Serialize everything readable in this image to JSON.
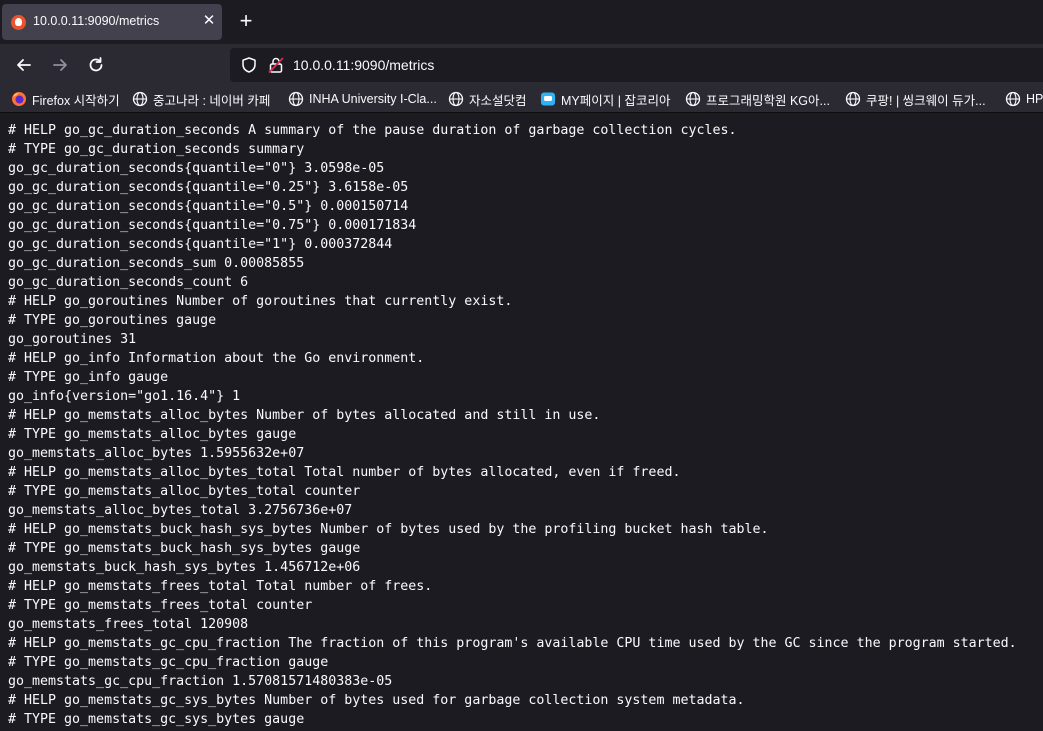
{
  "tab": {
    "title": "10.0.0.11:9090/metrics",
    "close": "✕"
  },
  "newtab": "+",
  "url": "10.0.0.11:9090/metrics",
  "bookmarks": [
    {
      "label": "Firefox 시작하기",
      "icon": "firefox-icon"
    },
    {
      "label": "중고나라 : 네이버 카페",
      "icon": "globe-icon"
    },
    {
      "label": "INHA University I-Cla...",
      "icon": "globe-icon"
    },
    {
      "label": "자소설닷컴",
      "icon": "globe-icon"
    },
    {
      "label": "MY페이지 | 잡코리아",
      "icon": "chat-icon"
    },
    {
      "label": "프로그래밍학원 KG아...",
      "icon": "globe-icon"
    },
    {
      "label": "쿠팡! | 씽크웨이 듀가...",
      "icon": "globe-icon"
    },
    {
      "label": "HP",
      "icon": "globe-icon"
    }
  ],
  "metrics_lines": [
    "# HELP go_gc_duration_seconds A summary of the pause duration of garbage collection cycles.",
    "# TYPE go_gc_duration_seconds summary",
    "go_gc_duration_seconds{quantile=\"0\"} 3.0598e-05",
    "go_gc_duration_seconds{quantile=\"0.25\"} 3.6158e-05",
    "go_gc_duration_seconds{quantile=\"0.5\"} 0.000150714",
    "go_gc_duration_seconds{quantile=\"0.75\"} 0.000171834",
    "go_gc_duration_seconds{quantile=\"1\"} 0.000372844",
    "go_gc_duration_seconds_sum 0.00085855",
    "go_gc_duration_seconds_count 6",
    "# HELP go_goroutines Number of goroutines that currently exist.",
    "# TYPE go_goroutines gauge",
    "go_goroutines 31",
    "# HELP go_info Information about the Go environment.",
    "# TYPE go_info gauge",
    "go_info{version=\"go1.16.4\"} 1",
    "# HELP go_memstats_alloc_bytes Number of bytes allocated and still in use.",
    "# TYPE go_memstats_alloc_bytes gauge",
    "go_memstats_alloc_bytes 1.5955632e+07",
    "# HELP go_memstats_alloc_bytes_total Total number of bytes allocated, even if freed.",
    "# TYPE go_memstats_alloc_bytes_total counter",
    "go_memstats_alloc_bytes_total 3.2756736e+07",
    "# HELP go_memstats_buck_hash_sys_bytes Number of bytes used by the profiling bucket hash table.",
    "# TYPE go_memstats_buck_hash_sys_bytes gauge",
    "go_memstats_buck_hash_sys_bytes 1.456712e+06",
    "# HELP go_memstats_frees_total Total number of frees.",
    "# TYPE go_memstats_frees_total counter",
    "go_memstats_frees_total 120908",
    "# HELP go_memstats_gc_cpu_fraction The fraction of this program's available CPU time used by the GC since the program started.",
    "# TYPE go_memstats_gc_cpu_fraction gauge",
    "go_memstats_gc_cpu_fraction 1.57081571480383e-05",
    "# HELP go_memstats_gc_sys_bytes Number of bytes used for garbage collection system metadata.",
    "# TYPE go_memstats_gc_sys_bytes gauge"
  ]
}
